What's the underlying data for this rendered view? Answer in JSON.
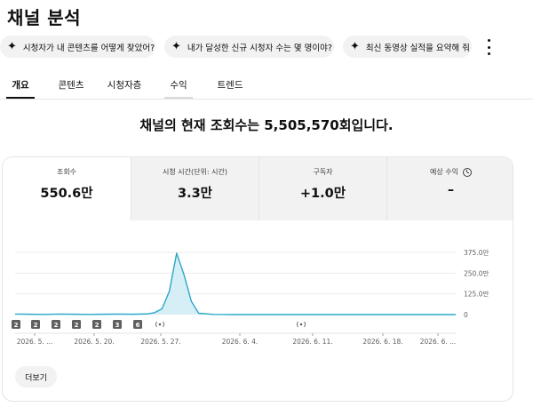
{
  "page": {
    "title": "채널 분석"
  },
  "chips": [
    {
      "label": "시청자가 내 콘텐츠를 어떻게 찾았어?",
      "icon": "sparkle-icon"
    },
    {
      "label": "내가 달성한 신규 시청자 수는 몇 명이야?",
      "icon": "sparkle-icon"
    },
    {
      "label": "최신 동영상 실적을 요약해 줘",
      "icon": "sparkle-icon"
    }
  ],
  "tabs": [
    {
      "label": "개요",
      "active": true
    },
    {
      "label": "콘텐츠",
      "active": false
    },
    {
      "label": "시청자층",
      "active": false
    },
    {
      "label": "수익",
      "active": false
    },
    {
      "label": "트렌드",
      "active": false
    }
  ],
  "headline": "채널의 현재 조회수는 5,505,570회입니다.",
  "metrics": [
    {
      "label": "조회수",
      "value": "550.6만",
      "selected": true
    },
    {
      "label": "시청 시간(단위: 시간)",
      "value": "3.3만",
      "selected": false
    },
    {
      "label": "구독자",
      "value": "+1.0만",
      "selected": false
    },
    {
      "label": "예상 수익",
      "value": "–",
      "selected": false,
      "icon": "clock-icon"
    }
  ],
  "chart_data": {
    "type": "area",
    "metric": "조회수",
    "y_ticks": [
      "375.0만",
      "250.0만",
      "125.0만",
      "0"
    ],
    "y_tick_values": [
      375,
      250,
      125,
      0
    ],
    "ylim": [
      0,
      375
    ],
    "y_unit": "만",
    "x_labels": [
      "2026. 5. ...",
      "2026. 5. 20.",
      "2026. 5. 27.",
      "2026. 6. 4.",
      "2026. 6. 11.",
      "2026. 6. 18.",
      "2026. 6. ..."
    ],
    "series": [
      {
        "days": [
          0,
          2,
          4,
          6,
          8,
          10,
          12,
          14,
          16,
          18,
          19,
          20,
          21,
          22,
          23,
          24,
          25,
          27,
          30,
          33,
          36,
          39,
          42,
          45,
          48,
          51,
          54,
          57,
          60
        ],
        "values": [
          3,
          2,
          1,
          3,
          2,
          1,
          2,
          3,
          2,
          4,
          12,
          35,
          140,
          370,
          240,
          80,
          8,
          1,
          0,
          0,
          0,
          0,
          0,
          0,
          0,
          0,
          0,
          0,
          0
        ]
      }
    ],
    "grid": true,
    "color": "#2aa7c9",
    "fill_color": "#d6eef5",
    "video_markers": [
      "2",
      "2",
      "2",
      "2",
      "2",
      "3",
      "6"
    ],
    "live_markers": 2,
    "live_icon": "live-broadcast-icon"
  },
  "more_button": {
    "label": "더보기"
  }
}
